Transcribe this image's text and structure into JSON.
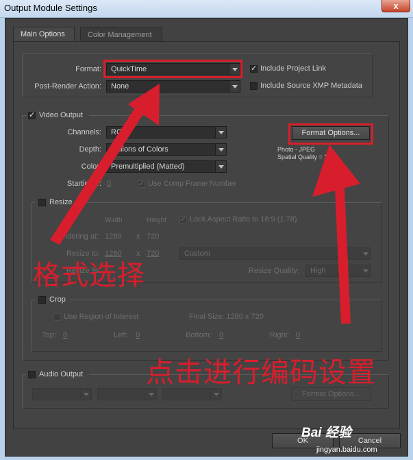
{
  "window": {
    "title": "Output Module Settings",
    "close_glyph": "x"
  },
  "tabs": [
    {
      "label": "Main Options",
      "active": true
    },
    {
      "label": "Color Management",
      "active": false
    }
  ],
  "format_section": {
    "format_label": "Format:",
    "format_value": "QuickTime",
    "post_render_label": "Post-Render Action:",
    "post_render_value": "None",
    "include_project_link": {
      "label": "Include Project Link",
      "checked": true
    },
    "include_xmp": {
      "label": "Include Source XMP Metadata",
      "checked": false
    }
  },
  "video_output": {
    "label": "Video Output",
    "checked": true,
    "channels_label": "Channels:",
    "channels_value": "RGB",
    "depth_label": "Depth:",
    "depth_value": "Millions of Colors",
    "color_label": "Color:",
    "color_value": "Premultiplied (Matted)",
    "starting_label": "Starting #:",
    "starting_value": "0",
    "use_comp_frame": {
      "label": "Use Comp Frame Number",
      "checked": true
    },
    "format_options_button": "Format Options...",
    "info_line1": "Photo - JPEG",
    "info_line2": "Spatial Quality = 100"
  },
  "resize": {
    "label": "Resize",
    "checked": false,
    "width_header": "Width",
    "height_header": "Height",
    "lock_aspect": {
      "label": "Lock Aspect Ratio to 16:9 (1.78)",
      "checked": true
    },
    "rendering_at_label": "Rendering at:",
    "rendering_w": "1280",
    "rendering_x": "x",
    "rendering_h": "720",
    "resize_to_label": "Resize to:",
    "resize_to_w": "1280",
    "resize_to_x": "x",
    "resize_to_h": "720",
    "preset_value": "Custom",
    "resize_pct_label": "Resize %:",
    "resize_pct_x": "x",
    "quality_label": "Resize Quality:",
    "quality_value": "High"
  },
  "crop": {
    "label": "Crop",
    "checked": false,
    "use_roi": {
      "label": "Use Region of Interest",
      "checked": false
    },
    "final_size": "Final Size: 1280 x 720",
    "top_label": "Top:",
    "top_value": "0",
    "left_label": "Left:",
    "left_value": "0",
    "bottom_label": "Bottom:",
    "bottom_value": "0",
    "right_label": "Right:",
    "right_value": "0"
  },
  "audio_output": {
    "label": "Audio Output",
    "checked": false,
    "format_options_button": "Format Options..."
  },
  "footer": {
    "ok": "OK",
    "cancel": "Cancel"
  },
  "annotations": {
    "format_select_text": "格式选择",
    "codec_settings_text": "点击进行编码设置",
    "color": "#d81e2c"
  },
  "watermark": {
    "logo_text": "Bai 经验",
    "url": "jingyan.baidu.com"
  }
}
